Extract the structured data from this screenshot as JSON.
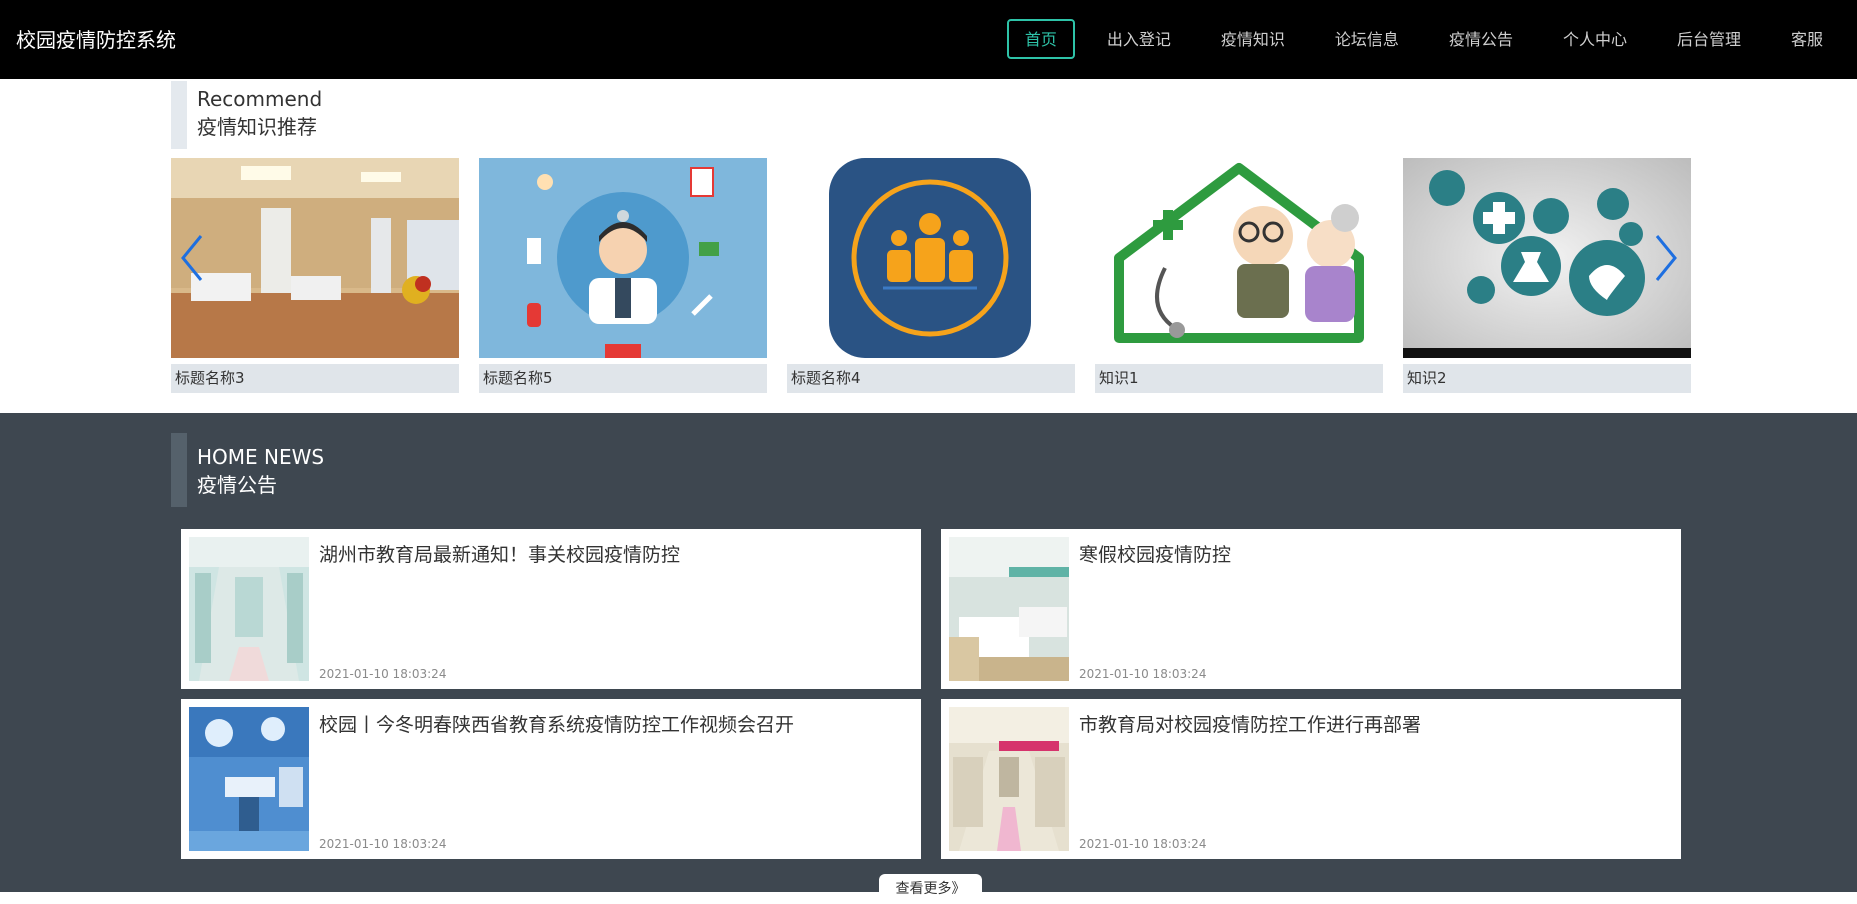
{
  "app": {
    "title": "校园疫情防控系统"
  },
  "nav": {
    "items": [
      {
        "label": "首页",
        "active": true
      },
      {
        "label": "出入登记"
      },
      {
        "label": "疫情知识"
      },
      {
        "label": "论坛信息"
      },
      {
        "label": "疫情公告"
      },
      {
        "label": "个人中心"
      },
      {
        "label": "后台管理"
      },
      {
        "label": "客服"
      }
    ]
  },
  "recommend": {
    "title_en": "Recommend",
    "title_zh": "疫情知识推荐",
    "cards": [
      {
        "caption": "标题名称3",
        "image": "hospital-ward-photo"
      },
      {
        "caption": "标题名称5",
        "image": "doctor-illustration"
      },
      {
        "caption": "标题名称4",
        "image": "medical-team-icon"
      },
      {
        "caption": "知识1",
        "image": "elderly-health-illustration"
      },
      {
        "caption": "知识2",
        "image": "medical-icons-collage"
      }
    ],
    "prev_icon": "chevron-left-icon",
    "next_icon": "chevron-right-icon"
  },
  "news": {
    "title_en": "HOME NEWS",
    "title_zh": "疫情公告",
    "items": [
      {
        "title": "湖州市教育局最新通知！事关校园疫情防控",
        "time": "2021-01-10 18:03:24",
        "image": "hospital-corridor-photo"
      },
      {
        "title": "寒假校园疫情防控",
        "time": "2021-01-10 18:03:24",
        "image": "hospital-beds-photo"
      },
      {
        "title": "校园丨今冬明春陕西省教育系统疫情防控工作视频会召开",
        "time": "2021-01-10 18:03:24",
        "image": "operating-room-photo"
      },
      {
        "title": "市教育局对校园疫情防控工作进行再部署",
        "time": "2021-01-10 18:03:24",
        "image": "hospital-hallway-photo"
      }
    ],
    "more_label": "查看更多》"
  },
  "colors": {
    "nav_bg": "#000000",
    "accent": "#2ec3a8",
    "news_bg": "#3e4750",
    "caption_bg": "#e0e5ea",
    "arrow": "#1e6fe0"
  }
}
